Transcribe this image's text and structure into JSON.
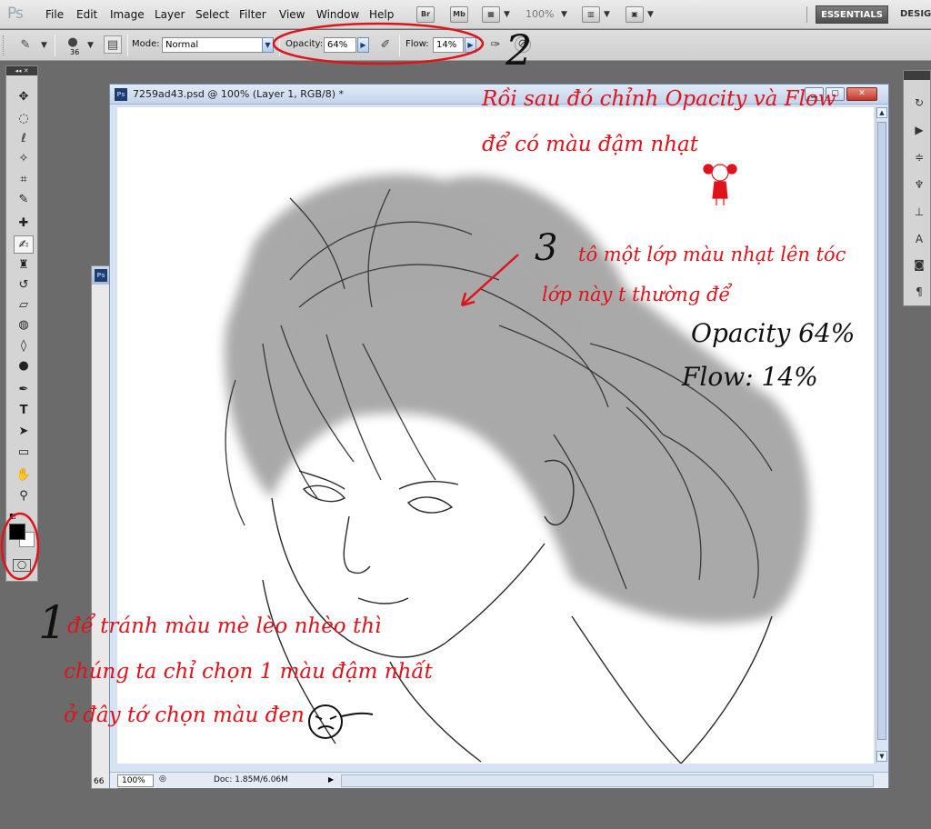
{
  "app": {
    "logo": "Ps"
  },
  "menu": [
    "File",
    "Edit",
    "Image",
    "Layer",
    "Select",
    "Filter",
    "View",
    "Window",
    "Help"
  ],
  "app_bar": {
    "bridge": "Br",
    "mini_bridge": "Mb",
    "zoom": "100%",
    "workspace_active": "ESSENTIALS",
    "workspace_next": "DESIG"
  },
  "options": {
    "brush_size": "36",
    "mode_label": "Mode:",
    "mode_value": "Normal",
    "opacity_label": "Opacity:",
    "opacity_value": "64%",
    "flow_label": "Flow:",
    "flow_value": "14%"
  },
  "document": {
    "title": "7259ad43.psd @ 100% (Layer 1, RGB/8) *",
    "zoom": "100%",
    "doc_info": "Doc: 1.85M/6.06M",
    "bg_doc_zoom": "66"
  },
  "annotations": {
    "step2_number": "2",
    "step2_line1": "Rồi sau đó chỉnh Opacity và Flow",
    "step2_line2": "để có màu đậm nhạt",
    "step3_number": "3",
    "step3_line1": "tô một lớp màu nhạt lên tóc",
    "step3_line2": "lớp này t thường để",
    "settings_opacity": "Opacity 64%",
    "settings_flow": "Flow: 14%",
    "step1_number": "1",
    "step1_line1": "để tránh màu mè lèo nhèo thì",
    "step1_line2": "chúng ta chỉ chọn 1 màu đậm nhất",
    "step1_line3": "ở đây tớ chọn màu đen"
  },
  "colors": {
    "annotation_red": "#e0121b",
    "foreground": "#000000",
    "background": "#ffffff"
  }
}
